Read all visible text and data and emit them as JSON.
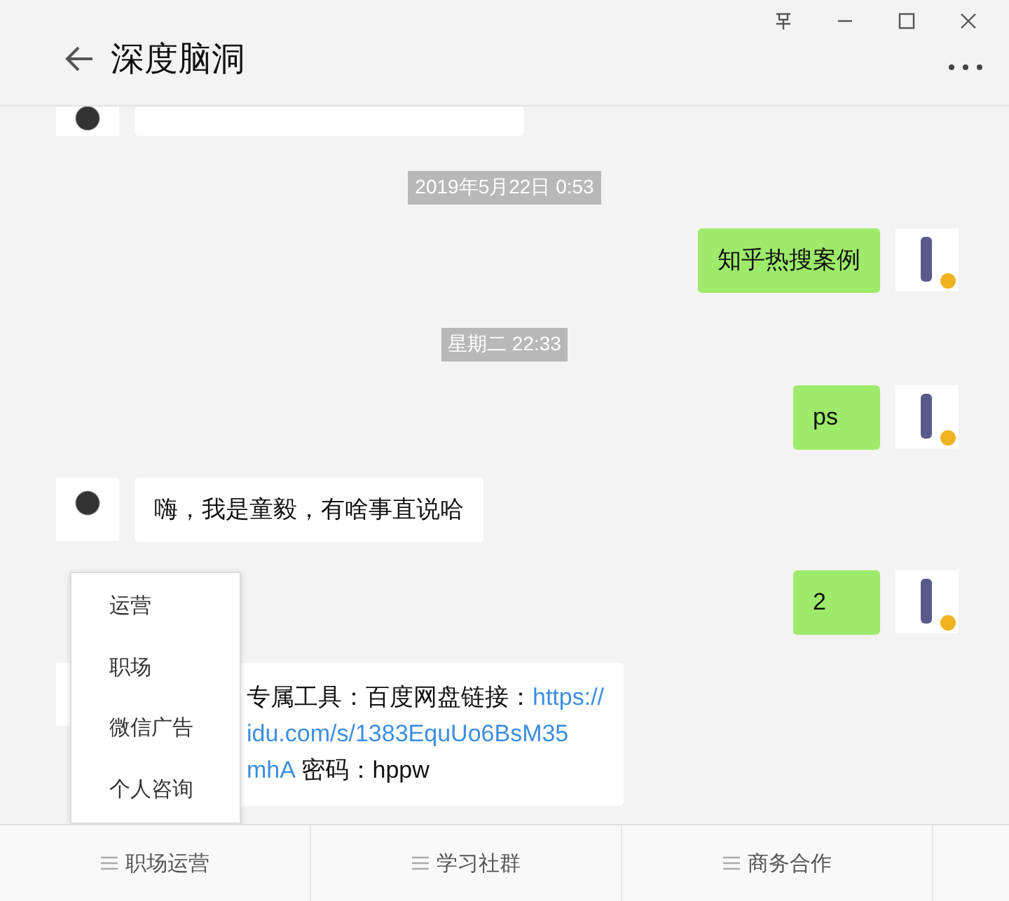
{
  "window": {
    "title": "深度脑洞"
  },
  "messages": [
    {
      "kind": "cutoff",
      "outgoing": false
    },
    {
      "kind": "time",
      "text": "2019年5月22日 0:53"
    },
    {
      "kind": "text",
      "outgoing": true,
      "text": "知乎热搜案例"
    },
    {
      "kind": "time",
      "text": "星期二 22:33"
    },
    {
      "kind": "text",
      "outgoing": true,
      "text": "ps"
    },
    {
      "kind": "text",
      "outgoing": false,
      "text": "嗨，我是童毅，有啥事直说哈"
    },
    {
      "kind": "text",
      "outgoing": true,
      "text": "2"
    },
    {
      "kind": "link_text",
      "outgoing": false,
      "prefix": "专属工具：百度网盘链接：",
      "link_lines": [
        "https://",
        "idu.com/s/1383EquUo6BsM35",
        "mhA"
      ],
      "suffix": " 密码：hppw"
    }
  ],
  "popup_menu": {
    "items": [
      "运营",
      "职场",
      "微信广告",
      "个人咨询"
    ]
  },
  "bottom_menu": [
    {
      "label": "职场运营"
    },
    {
      "label": "学习社群"
    },
    {
      "label": "商务合作"
    }
  ]
}
